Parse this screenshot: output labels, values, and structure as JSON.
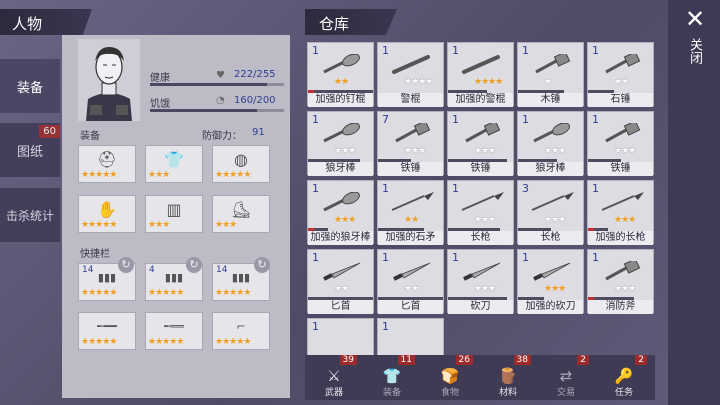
{
  "left_panel": {
    "title": "人物",
    "tabs": [
      {
        "label": "装备"
      },
      {
        "label": "图纸",
        "badge": "60"
      },
      {
        "label": "击杀统计"
      }
    ],
    "stats": [
      {
        "label": "健康",
        "value": "222/255",
        "icon": "heart-icon",
        "fill": 0.87
      },
      {
        "label": "饥饿",
        "value": "160/200",
        "icon": "stomach-icon",
        "fill": 0.8
      }
    ],
    "equipment_label": "装备",
    "defense_label": "防御力：",
    "defense_value": "91",
    "equipment": [
      {
        "icon": "helmet-icon",
        "stars": 5
      },
      {
        "icon": "vest-icon",
        "stars": 3
      },
      {
        "icon": "shield-icon",
        "stars": 5
      },
      {
        "icon": "gloves-icon",
        "stars": 5
      },
      {
        "icon": "pants-icon",
        "stars": 3
      },
      {
        "icon": "boots-icon",
        "stars": 3
      }
    ],
    "quickbar_label": "快捷栏",
    "quickbar": [
      {
        "qty": "14",
        "icon": "ammo-icon",
        "stars": 5
      },
      {
        "qty": "4",
        "icon": "ammo-icon",
        "stars": 5
      },
      {
        "qty": "14",
        "icon": "ammo-icon",
        "stars": 5
      },
      {
        "qty": "",
        "icon": "rifle-icon",
        "stars": 5
      },
      {
        "qty": "",
        "icon": "shotgun-icon",
        "stars": 5
      },
      {
        "qty": "",
        "icon": "revolver-icon",
        "stars": 5
      }
    ]
  },
  "warehouse": {
    "title": "仓库",
    "items": [
      {
        "num": "1",
        "name": "加强的钉棍",
        "gold": 2,
        "white": 0,
        "icon": "spiked-club-icon",
        "dur": 1,
        "red": true
      },
      {
        "num": "1",
        "name": "警棍",
        "gold": 0,
        "white": 4,
        "icon": "baton-icon",
        "dur": 0,
        "red": false
      },
      {
        "num": "1",
        "name": "加强的警棍",
        "gold": 4,
        "white": 0,
        "icon": "baton-icon",
        "dur": 0.6,
        "red": false
      },
      {
        "num": "1",
        "name": "木锤",
        "gold": 0,
        "white": 1,
        "icon": "hammer-icon",
        "dur": 0.7,
        "red": false
      },
      {
        "num": "1",
        "name": "石锤",
        "gold": 0,
        "white": 2,
        "icon": "hammer-icon",
        "dur": 0.4,
        "red": false
      },
      {
        "num": "1",
        "name": "狼牙棒",
        "gold": 0,
        "white": 3,
        "icon": "mace-icon",
        "dur": 0.8,
        "red": false
      },
      {
        "num": "7",
        "name": "铁锤",
        "gold": 0,
        "white": 3,
        "icon": "hammer-icon",
        "dur": 0.5,
        "red": false
      },
      {
        "num": "1",
        "name": "铁锤",
        "gold": 0,
        "white": 3,
        "icon": "hammer-icon",
        "dur": 0.9,
        "red": false
      },
      {
        "num": "1",
        "name": "狼牙棒",
        "gold": 0,
        "white": 3,
        "icon": "mace-icon",
        "dur": 0.6,
        "red": false
      },
      {
        "num": "1",
        "name": "铁锤",
        "gold": 0,
        "white": 3,
        "icon": "hammer-icon",
        "dur": 0.5,
        "red": false
      },
      {
        "num": "1",
        "name": "加强的狼牙棒",
        "gold": 3,
        "white": 0,
        "icon": "mace-icon",
        "dur": 0.3,
        "red": true
      },
      {
        "num": "1",
        "name": "加强的石矛",
        "gold": 2,
        "white": 0,
        "icon": "spear-icon",
        "dur": 0.7,
        "red": false
      },
      {
        "num": "1",
        "name": "长枪",
        "gold": 0,
        "white": 3,
        "icon": "spear-icon",
        "dur": 0.8,
        "red": false
      },
      {
        "num": "3",
        "name": "长枪",
        "gold": 0,
        "white": 3,
        "icon": "spear-icon",
        "dur": 0.5,
        "red": false
      },
      {
        "num": "1",
        "name": "加强的长枪",
        "gold": 3,
        "white": 0,
        "icon": "spear-icon",
        "dur": 0.3,
        "red": true
      },
      {
        "num": "1",
        "name": "匕首",
        "gold": 0,
        "white": 2,
        "icon": "dagger-icon",
        "dur": 1,
        "red": false
      },
      {
        "num": "1",
        "name": "匕首",
        "gold": 0,
        "white": 2,
        "icon": "dagger-icon",
        "dur": 1,
        "red": false
      },
      {
        "num": "1",
        "name": "砍刀",
        "gold": 0,
        "white": 3,
        "icon": "machete-icon",
        "dur": 0.9,
        "red": false
      },
      {
        "num": "1",
        "name": "加强的砍刀",
        "gold": 3,
        "white": 0,
        "icon": "machete-icon",
        "dur": 0.4,
        "red": false
      },
      {
        "num": "1",
        "name": "消防斧",
        "gold": 0,
        "white": 3,
        "icon": "axe-icon",
        "dur": 0.7,
        "red": true
      },
      {
        "num": "1",
        "name": "",
        "gold": 0,
        "white": 0,
        "icon": "",
        "dur": 0,
        "red": false
      },
      {
        "num": "1",
        "name": "",
        "gold": 0,
        "white": 0,
        "icon": "",
        "dur": 0,
        "red": false
      }
    ],
    "tabs": [
      {
        "label": "武器",
        "count": "39",
        "icon": "weapon-icon",
        "dim": false
      },
      {
        "label": "装备",
        "count": "11",
        "icon": "armor-icon",
        "dim": true
      },
      {
        "label": "食物",
        "count": "26",
        "icon": "food-icon",
        "dim": true
      },
      {
        "label": "材料",
        "count": "38",
        "icon": "material-icon",
        "dim": false
      },
      {
        "label": "交易",
        "count": "2",
        "icon": "trade-icon",
        "dim": true
      },
      {
        "label": "任务",
        "count": "2",
        "icon": "key-icon",
        "dim": false
      }
    ]
  },
  "close_label": "关闭"
}
